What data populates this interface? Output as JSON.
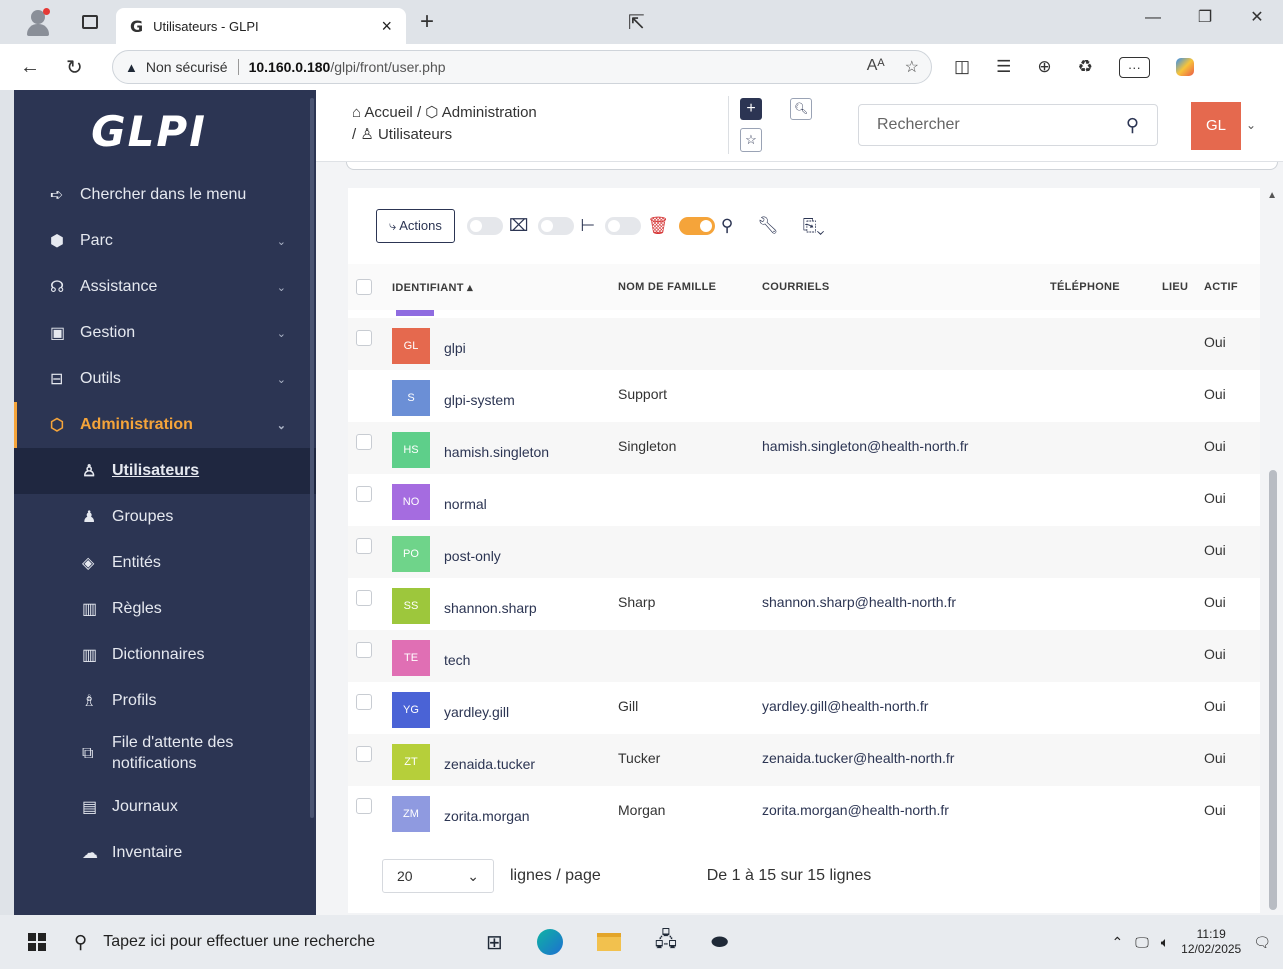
{
  "browser": {
    "tab_title": "Utilisateurs - GLPI",
    "tab_favicon": "G",
    "not_secure": "Non sécurisé",
    "url_host": "10.160.0.180",
    "url_path": "/glpi/front/user.php"
  },
  "sidebar": {
    "logo": "GLPI",
    "items": [
      {
        "label": "Chercher dans le menu",
        "icon": "arrow-icon"
      },
      {
        "label": "Parc",
        "icon": "box-icon"
      },
      {
        "label": "Assistance",
        "icon": "headset-icon"
      },
      {
        "label": "Gestion",
        "icon": "wallet-icon"
      },
      {
        "label": "Outils",
        "icon": "briefcase-icon"
      },
      {
        "label": "Administration",
        "icon": "shield-icon"
      }
    ],
    "sub_items": [
      {
        "label": "Utilisateurs"
      },
      {
        "label": "Groupes"
      },
      {
        "label": "Entités"
      },
      {
        "label": "Règles"
      },
      {
        "label": "Dictionnaires"
      },
      {
        "label": "Profils"
      },
      {
        "label": "File d'attente des notifications"
      },
      {
        "label": "Journaux"
      },
      {
        "label": "Inventaire"
      }
    ]
  },
  "header": {
    "crumb_home": "Accueil",
    "crumb_admin": "Administration",
    "crumb_users": "Utilisateurs",
    "search_placeholder": "Rechercher",
    "user_initials": "GL"
  },
  "toolbar": {
    "actions_label": "Actions"
  },
  "table": {
    "headers": [
      "IDENTIFIANT",
      "NOM DE FAMILLE",
      "COURRIELS",
      "TÉLÉPHONE",
      "LIEU",
      "ACTIF"
    ],
    "rows": [
      {
        "initials": "GL",
        "color": "#e5694e",
        "login": "glpi",
        "lastname": "",
        "email": "",
        "active": "Oui",
        "checkbox": true
      },
      {
        "initials": "S",
        "color": "#6b8fd6",
        "login": "glpi-system",
        "lastname": "Support",
        "email": "",
        "active": "Oui",
        "checkbox": false
      },
      {
        "initials": "HS",
        "color": "#5ecf8a",
        "login": "hamish.singleton",
        "lastname": "Singleton",
        "email": "hamish.singleton@health-north.fr",
        "active": "Oui",
        "checkbox": true
      },
      {
        "initials": "NO",
        "color": "#a56ce0",
        "login": "normal",
        "lastname": "",
        "email": "",
        "active": "Oui",
        "checkbox": true
      },
      {
        "initials": "PO",
        "color": "#6fd48a",
        "login": "post-only",
        "lastname": "",
        "email": "",
        "active": "Oui",
        "checkbox": true
      },
      {
        "initials": "SS",
        "color": "#9dc73c",
        "login": "shannon.sharp",
        "lastname": "Sharp",
        "email": "shannon.sharp@health-north.fr",
        "active": "Oui",
        "checkbox": true
      },
      {
        "initials": "TE",
        "color": "#e06fb4",
        "login": "tech",
        "lastname": "",
        "email": "",
        "active": "Oui",
        "checkbox": true
      },
      {
        "initials": "YG",
        "color": "#4a63d6",
        "login": "yardley.gill",
        "lastname": "Gill",
        "email": "yardley.gill@health-north.fr",
        "active": "Oui",
        "checkbox": true
      },
      {
        "initials": "ZT",
        "color": "#b6cf3a",
        "login": "zenaida.tucker",
        "lastname": "Tucker",
        "email": "zenaida.tucker@health-north.fr",
        "active": "Oui",
        "checkbox": true
      },
      {
        "initials": "ZM",
        "color": "#8f9ae0",
        "login": "zorita.morgan",
        "lastname": "Morgan",
        "email": "zorita.morgan@health-north.fr",
        "active": "Oui",
        "checkbox": true
      }
    ]
  },
  "pager": {
    "per_page": "20",
    "per_page_label": "lignes / page",
    "summary": "De 1 à 15 sur 15 lignes"
  },
  "taskbar": {
    "search_placeholder": "Tapez ici pour effectuer une recherche",
    "time": "11:19",
    "date": "12/02/2025"
  }
}
